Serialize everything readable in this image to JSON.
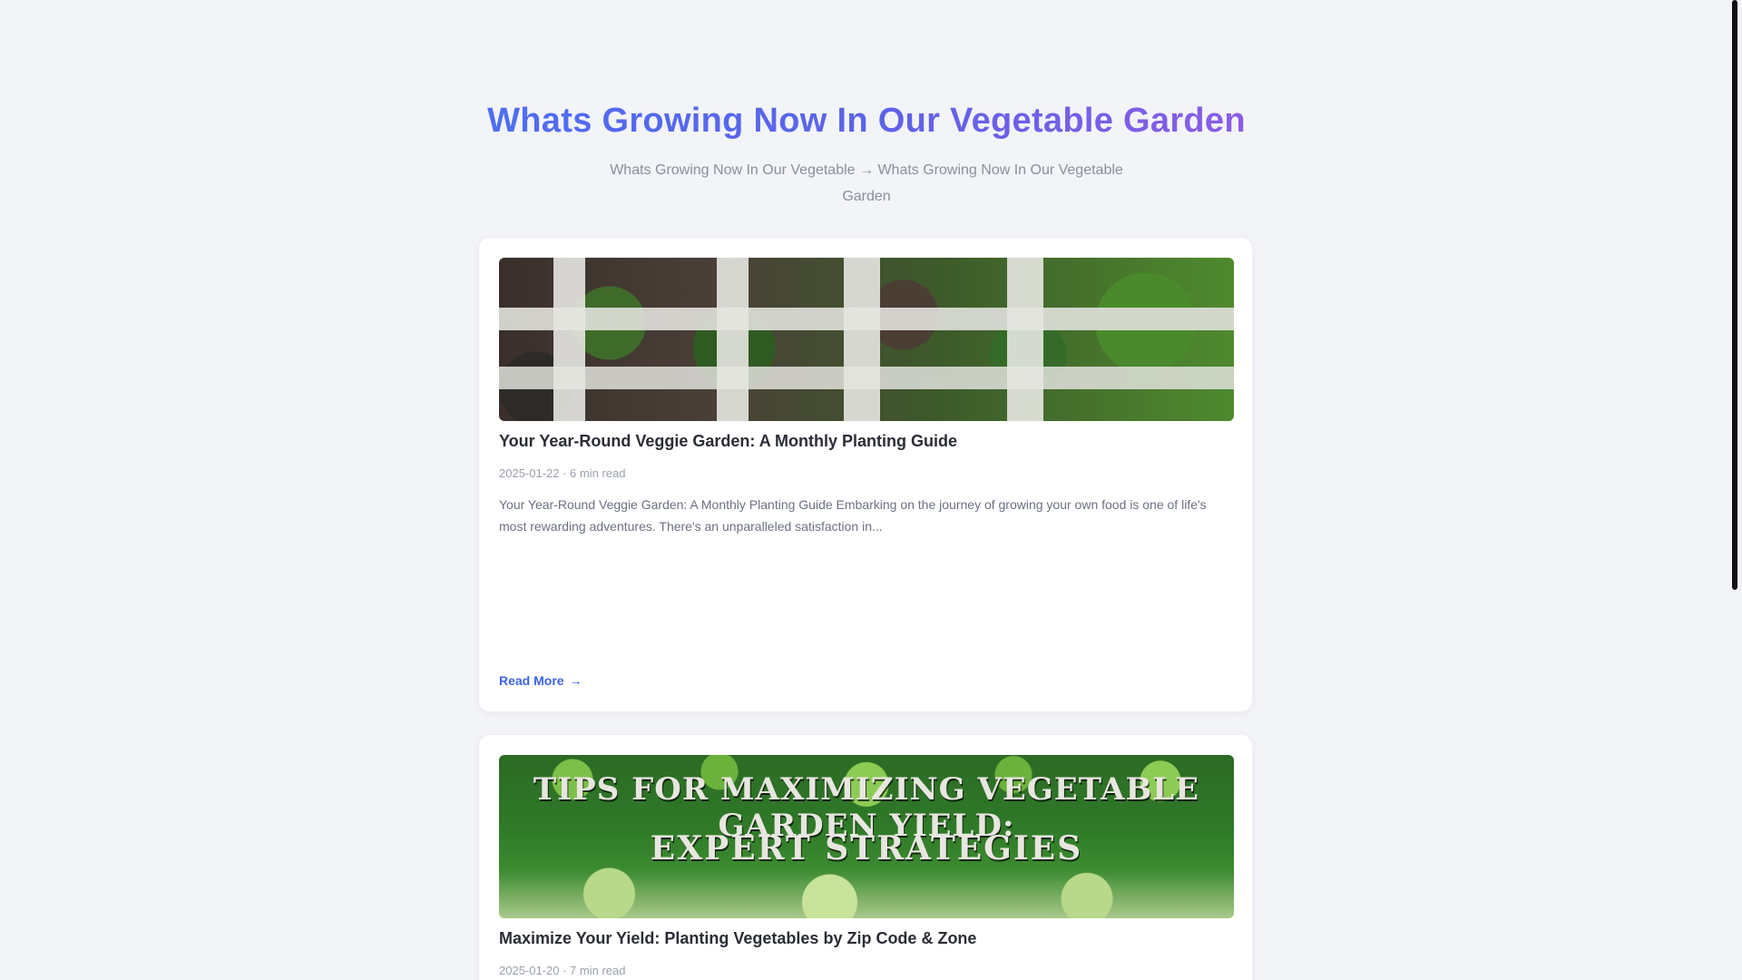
{
  "header": {
    "title": "Whats Growing Now In Our Vegetable Garden",
    "breadcrumb": "Whats Growing Now In Our Vegetable → Whats Growing Now In Our Vegetable Garden"
  },
  "posts": [
    {
      "title": "Your Year-Round Veggie Garden: A Monthly Planting Guide",
      "meta": "2025-01-22 · 6 min read",
      "excerpt": "Your Year-Round Veggie Garden: A Monthly Planting Guide Embarking on the journey of growing your own food is one of life's most rewarding adventures. There's an unparalleled satisfaction in...",
      "read_more": "Read More",
      "image_icon": "garden-photo-icon"
    },
    {
      "title": "Maximize Your Yield: Planting Vegetables by Zip Code & Zone",
      "meta": "2025-01-20 · 7 min read",
      "image_text_line1": "TIPS FOR MAXIMIZING VEGETABLE GARDEN YIELD:",
      "image_text_line2": "EXPERT STRATEGIES",
      "image_icon": "vegetable-photo-icon"
    }
  ],
  "colors": {
    "accent": "#3b63e6",
    "title_gradient_start": "#4f6ef2",
    "title_gradient_end": "#8b5ce6",
    "background": "#f3f4f8"
  }
}
